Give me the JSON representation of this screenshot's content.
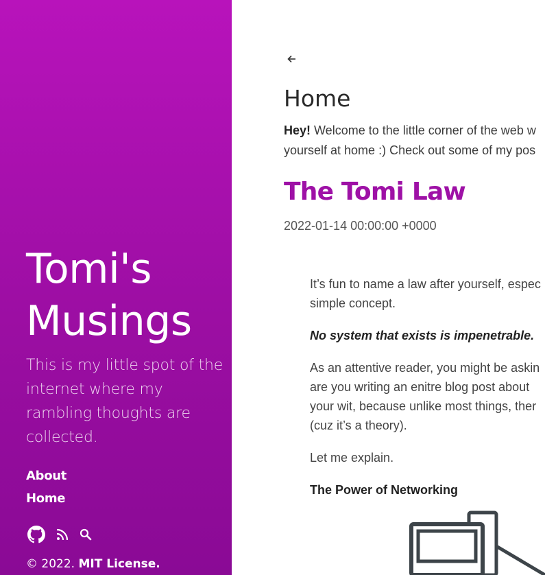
{
  "sidebar": {
    "title_line1": "Tomi's",
    "title_line2": "Musings",
    "description_lines": [
      "This is my little spot of the",
      "internet where my",
      "rambling thoughts are",
      "collected."
    ],
    "nav": [
      {
        "label": "About"
      },
      {
        "label": "Home"
      }
    ],
    "icons": [
      "github-icon",
      "rss-icon",
      "search-icon"
    ],
    "copyright": "© 2022.",
    "license": "MIT License.",
    "gradient_top": "#b813bb",
    "gradient_bottom": "#8a0a95"
  },
  "main": {
    "back_icon": "arrow-left-icon",
    "page_title": "Home",
    "intro": {
      "bold": "Hey!",
      "line1_rest": " Welcome to the little corner of the web w",
      "line2": "yourself at home :) Check out some of my pos"
    },
    "post": {
      "title": "The Tomi Law",
      "date": "2022-01-14 00:00:00 +0000",
      "para1_line1": "It’s fun to name a law after yourself, espec",
      "para1_line2": "simple concept.",
      "law": "No system that exists is impenetrable.",
      "para2_lines": [
        "As an attentive reader, you might be askin",
        "are you writing an enitre blog post about",
        "your wit, because unlike most things, ther",
        "(cuz it’s a theory)."
      ],
      "para3": "Let me explain.",
      "heading": "The Power of Networking",
      "illustration_icon": "computer-network-icon"
    },
    "title_color": "#9e11a6"
  }
}
